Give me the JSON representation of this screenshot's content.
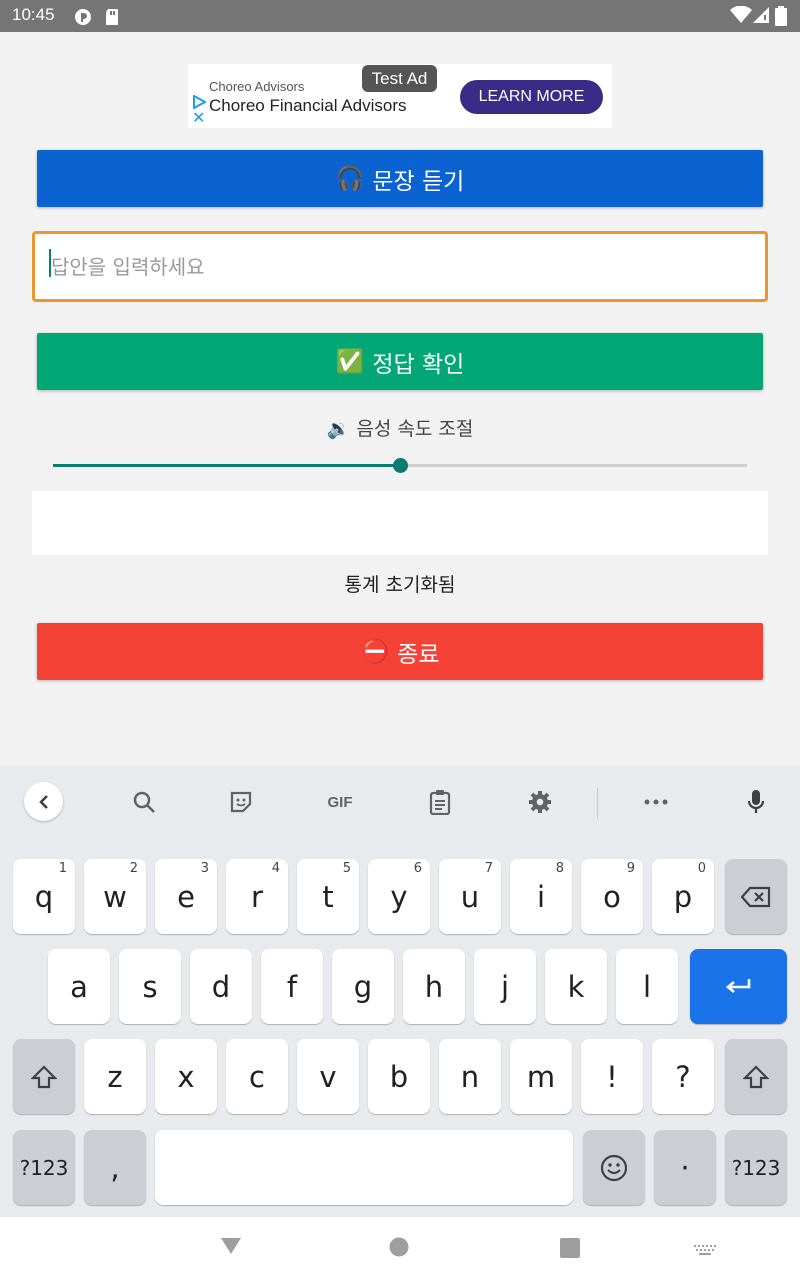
{
  "status_bar": {
    "time": "10:45",
    "icons": [
      "media-icon",
      "sd-card-icon",
      "wifi-icon",
      "signal-icon",
      "battery-icon"
    ]
  },
  "ad": {
    "badge": "Test Ad",
    "advertiser_small": "Choreo Advisors",
    "advertiser_big": "Choreo Financial Advisors",
    "cta": "LEARN MORE",
    "cta_color": "#3a2c86"
  },
  "main": {
    "listen_button": {
      "emoji": "🎧",
      "label": "문장 듣기",
      "color": "#0a63d1"
    },
    "answer_input": {
      "placeholder": "답안을 입력하세요",
      "value": ""
    },
    "check_button": {
      "emoji": "✅",
      "label": "정답 확인",
      "color": "#01a876"
    },
    "speed_label": "🔉 음성 속도 조절",
    "speed_slider_value": 0.5,
    "stats_text": "통계 초기화됨",
    "exit_button": {
      "emoji": "⛔",
      "label": "종료",
      "color": "#f44336"
    }
  },
  "keyboard": {
    "toolbar": [
      "back-icon",
      "search-icon",
      "sticker-icon",
      "gif-icon",
      "clipboard-icon",
      "settings-icon",
      "more-icon",
      "mic-icon"
    ],
    "gif_label": "GIF",
    "row1": [
      {
        "k": "q",
        "h": "1"
      },
      {
        "k": "w",
        "h": "2"
      },
      {
        "k": "e",
        "h": "3"
      },
      {
        "k": "r",
        "h": "4"
      },
      {
        "k": "t",
        "h": "5"
      },
      {
        "k": "y",
        "h": "6"
      },
      {
        "k": "u",
        "h": "7"
      },
      {
        "k": "i",
        "h": "8"
      },
      {
        "k": "o",
        "h": "9"
      },
      {
        "k": "p",
        "h": "0"
      }
    ],
    "row2": [
      "a",
      "s",
      "d",
      "f",
      "g",
      "h",
      "j",
      "k",
      "l"
    ],
    "row3": [
      "z",
      "x",
      "c",
      "v",
      "b",
      "n",
      "m",
      "!",
      "?"
    ],
    "symbols_label": "?123",
    "comma": ",",
    "period": "·"
  },
  "accent": "#0b7c72"
}
